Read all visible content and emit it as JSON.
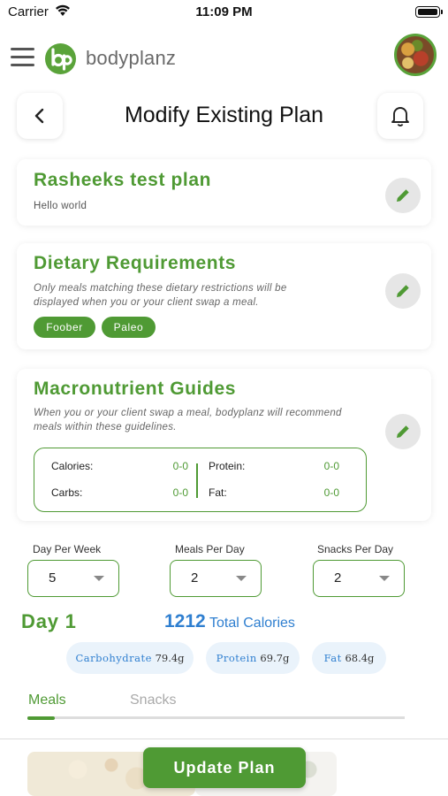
{
  "status_bar": {
    "carrier": "Carrier",
    "time": "11:09 PM"
  },
  "brand": {
    "name": "bodyplanz",
    "color": "#5aa33a"
  },
  "header": {
    "title": "Modify Existing Plan"
  },
  "plan_card": {
    "title": "Rasheeks test plan",
    "description": "Hello world"
  },
  "dietary_card": {
    "title": "Dietary Requirements",
    "description_line1": "Only meals matching these dietary restrictions will be",
    "description_line2": "displayed when you or your client swap a meal.",
    "tags": [
      "Foober",
      "Paleo"
    ]
  },
  "macro_card": {
    "title": "Macronutrient Guides",
    "description_line1": "When you or your client swap a meal, bodyplanz will recommend",
    "description_line2": "meals within these guidelines.",
    "items": [
      {
        "label": "Calories:",
        "value": "0-0"
      },
      {
        "label": "Carbs:",
        "value": "0-0"
      },
      {
        "label": "Protein:",
        "value": "0-0"
      },
      {
        "label": "Fat:",
        "value": "0-0"
      }
    ]
  },
  "selectors": [
    {
      "label": "Day Per Week",
      "value": "5"
    },
    {
      "label": "Meals Per Day",
      "value": "2"
    },
    {
      "label": "Snacks Per Day",
      "value": "2"
    }
  ],
  "day_summary": {
    "day": "Day 1",
    "total_calories": "1212",
    "total_label": "Total Calories",
    "macros": [
      {
        "name": "Carbohydrate",
        "value": "79.4g"
      },
      {
        "name": "Protein",
        "value": "69.7g"
      },
      {
        "name": "Fat",
        "value": "68.4g"
      }
    ]
  },
  "tabs": [
    {
      "label": "Meals",
      "active": true
    },
    {
      "label": "Snacks",
      "active": false
    }
  ],
  "actions": {
    "update_label": "Update Plan"
  },
  "colors": {
    "accent_green": "#4f9a34",
    "accent_blue": "#2f7fd0"
  }
}
